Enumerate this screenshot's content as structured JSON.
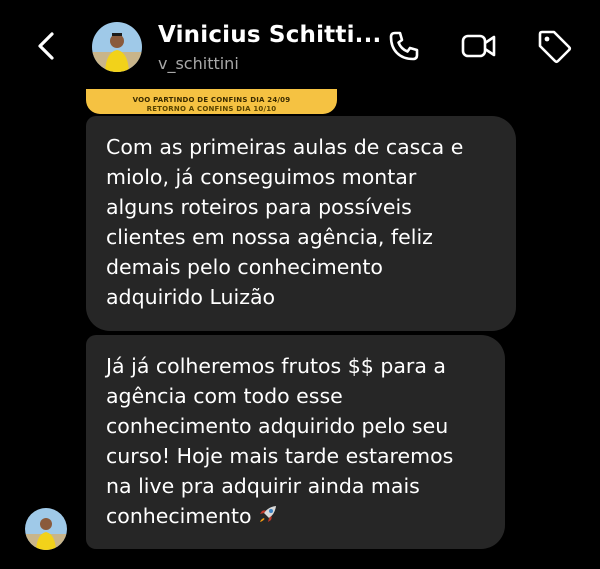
{
  "header": {
    "back_icon": "chevron-left-icon",
    "contact_name": "Vinicius Schitti...",
    "username": "v_schittini",
    "call_icon": "phone-icon",
    "video_icon": "video-camera-icon",
    "tag_icon": "tag-icon"
  },
  "story_reply": {
    "line1": "VOO PARTINDO DE CONFINS DIA 24/09",
    "line2": "RETORNO A CONFINS DIA 10/10",
    "color": "#f5c242"
  },
  "messages": [
    {
      "lines": [
        "Com as primeiras aulas de casca e",
        "miolo, já conseguimos montar",
        "alguns roteiros para possíveis",
        "clientes em nossa agência, feliz",
        "demais pelo conhecimento",
        "adquirido Luizão"
      ]
    },
    {
      "lines": [
        "Já já colheremos frutos $$ para a",
        "agência com todo esse",
        "conhecimento adquirido pelo seu",
        "curso! Hoje mais tarde estaremos",
        "na live pra adquirir ainda mais",
        "conhecimento"
      ],
      "emoji": "rocket-icon"
    }
  ],
  "colors": {
    "background": "#000000",
    "bubble": "#262626",
    "text": "#ffffff",
    "subtext": "#a8a8a8"
  }
}
